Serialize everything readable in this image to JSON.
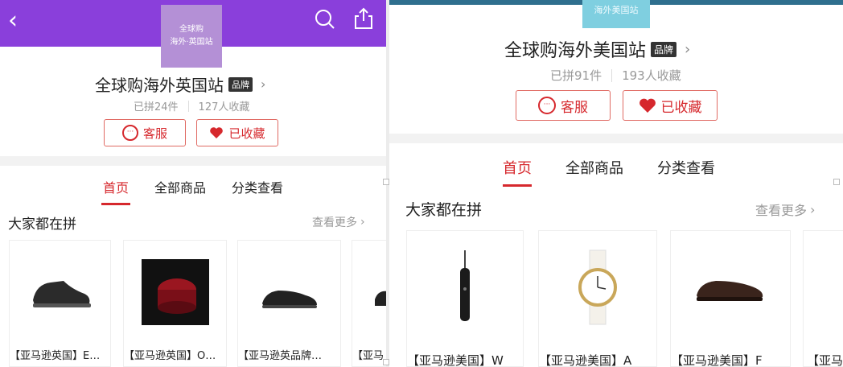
{
  "left": {
    "logo_lines": [
      "全球购",
      "海外·英国站"
    ],
    "shop_name": "全球购海外英国站",
    "brand_badge": "品牌",
    "chevron": "›",
    "stat_group": "已拼24件",
    "stat_fav": "127人收藏",
    "service_label": "客服",
    "fav_label": "已收藏",
    "tabs": [
      "首页",
      "全部商品",
      "分类查看"
    ],
    "section_title": "大家都在拼",
    "more_label": "查看更多",
    "products": [
      {
        "name": "【亚马逊英国】E…",
        "icon": "black-sneaker"
      },
      {
        "name": "【亚马逊英国】O…",
        "icon": "red-cream-jar"
      },
      {
        "name": "【亚马逊英品牌…",
        "icon": "black-loafer"
      },
      {
        "name": "【亚马",
        "icon": "black-shoe"
      }
    ]
  },
  "right": {
    "logo_text": "海外美国站",
    "shop_name": "全球购海外美国站",
    "brand_badge": "品牌",
    "chevron": "›",
    "stat_group": "已拼91件",
    "stat_fav": "193人收藏",
    "service_label": "客服",
    "fav_label": "已收藏",
    "tabs": [
      "首页",
      "全部商品",
      "分类查看"
    ],
    "section_title": "大家都在拼",
    "more_label": "查看更多",
    "products": [
      {
        "name": "【亚马逊美国】W",
        "icon": "water-flosser"
      },
      {
        "name": "【亚马逊美国】A",
        "icon": "white-watch"
      },
      {
        "name": "【亚马逊美国】F",
        "icon": "brown-loafer"
      },
      {
        "name": "【亚马",
        "icon": "partial-item"
      }
    ]
  },
  "colors": {
    "accent": "#d6282d",
    "header_purple": "#8a3fdb",
    "header_blue": "#2f6f8e"
  }
}
